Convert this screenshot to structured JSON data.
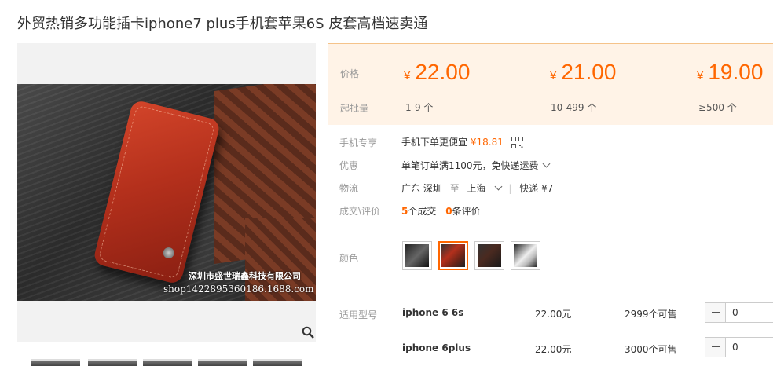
{
  "product": {
    "title": "外贸热销多功能插卡iphone7 plus手机套苹果6S 皮套高档速卖通"
  },
  "gallery": {
    "watermark_company": "深圳市盛世瑞鑫科技有限公司",
    "watermark_shop": "shop1422895360186.1688.com",
    "zoom_icon": "magnifier-icon"
  },
  "pricing": {
    "price_label": "价格",
    "qty_label": "起批量",
    "currency": "¥",
    "tiers": [
      {
        "price": "22.00",
        "range": "1-9 个"
      },
      {
        "price": "21.00",
        "range": "10-499 个"
      },
      {
        "price": "19.00",
        "range": "≥500 个"
      }
    ]
  },
  "info": {
    "mobile_label": "手机专享",
    "mobile_text": "手机下单更便宜",
    "mobile_price": "¥18.81",
    "promo_label": "优惠",
    "promo_text": "单笔订单满1100元，免快递运费",
    "logistics_label": "物流",
    "from_province": "广东",
    "from_city": "深圳",
    "to_word": "至",
    "to_city": "上海",
    "shipping_text": "快递 ¥7",
    "deal_label": "成交\\评价",
    "deal_count": "5",
    "deal_suffix": "个成交",
    "review_count": "0",
    "review_suffix": "条评价"
  },
  "color": {
    "label": "颜色",
    "selected_index": 1,
    "swatches": [
      "black",
      "red",
      "dark-brown",
      "white"
    ]
  },
  "models": {
    "label": "适用型号",
    "rows": [
      {
        "name": "iphone 6 6s",
        "price": "22.00元",
        "stock": "2999个可售",
        "qty": "0"
      },
      {
        "name": "iphone 6plus",
        "price": "22.00元",
        "stock": "3000个可售",
        "qty": "0"
      }
    ]
  },
  "colors": {
    "accent": "#ff6600",
    "price_bg": "#fff3e7"
  }
}
